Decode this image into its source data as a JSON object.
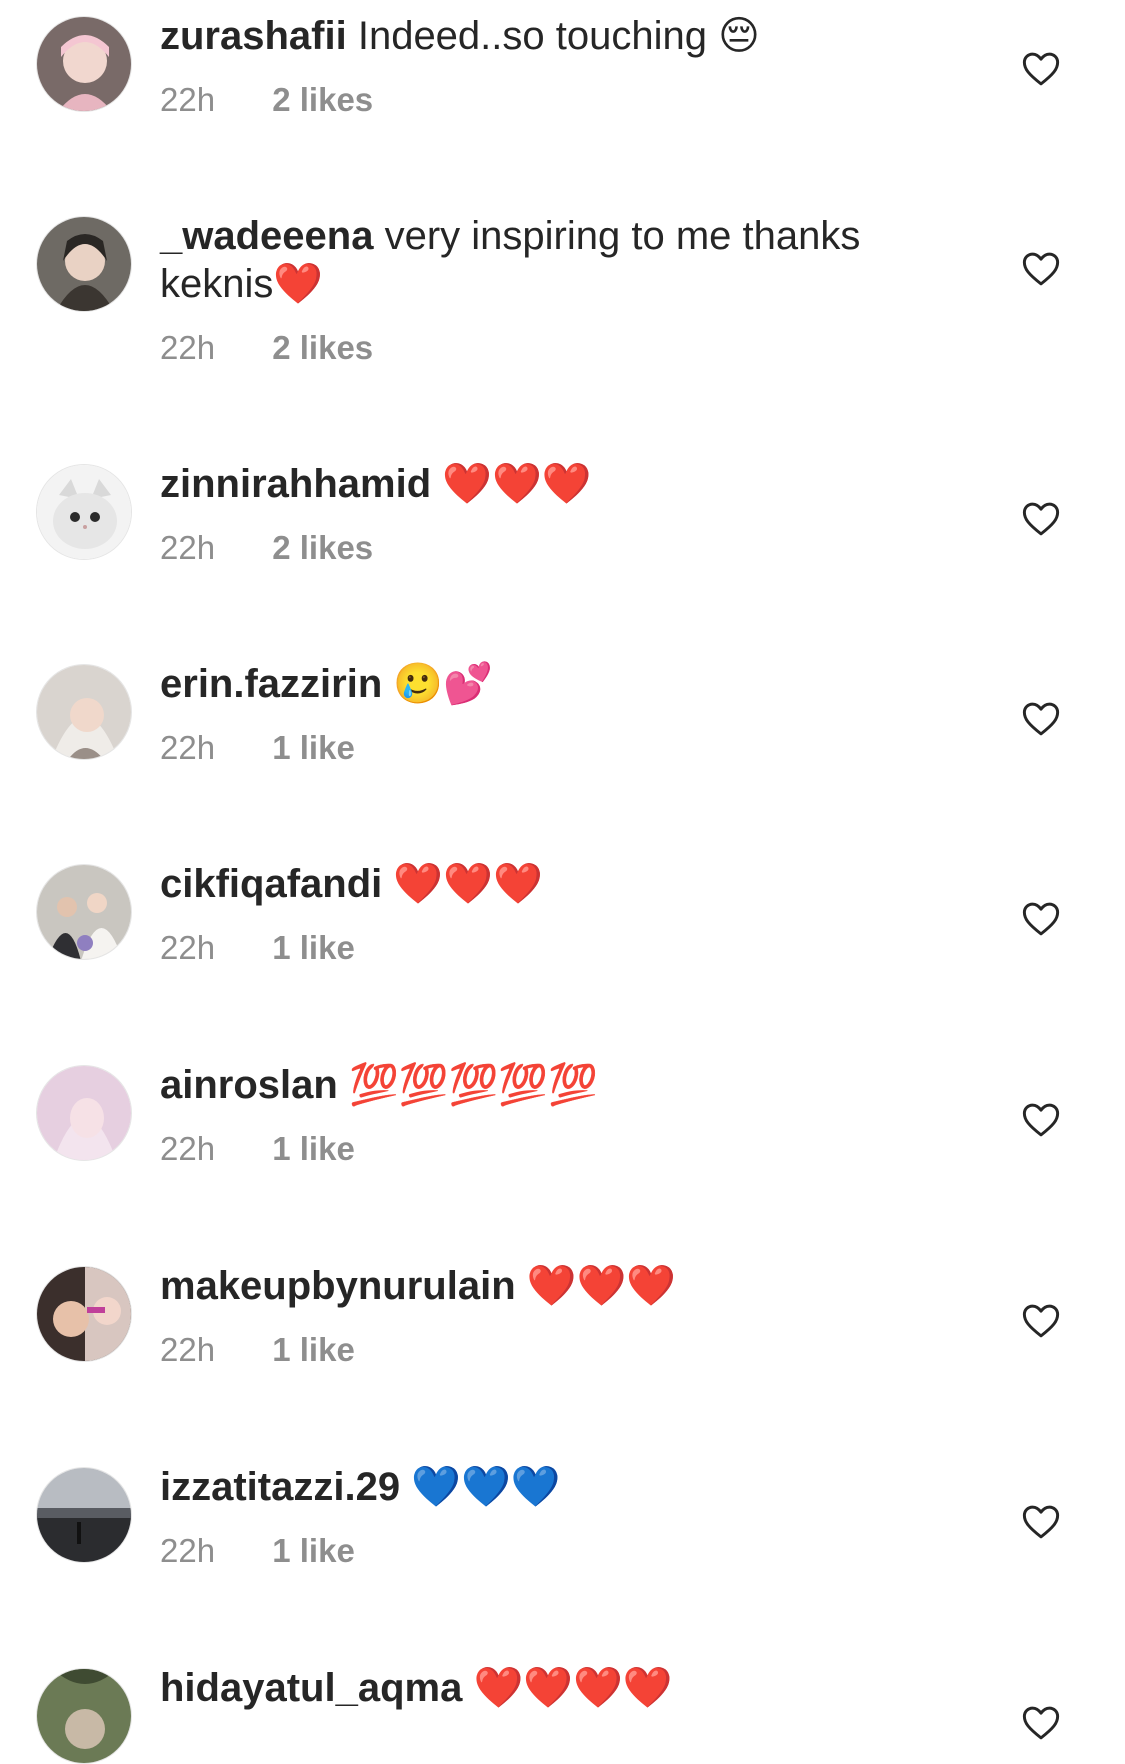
{
  "comments": [
    {
      "username": "zurashafii",
      "text": " Indeed..so touching 😔",
      "time": "22h",
      "likes": "2 likes",
      "avatar_color": "#d6c8c2"
    },
    {
      "username": "_wadeeena",
      "text": " very inspiring to me thanks keknis❤️",
      "time": "22h",
      "likes": "2 likes",
      "avatar_color": "#6e6a64"
    },
    {
      "username": "zinnirahhamid",
      "text": " ❤️❤️❤️",
      "time": "22h",
      "likes": "2 likes",
      "avatar_color": "#eeeeee"
    },
    {
      "username": "erin.fazzirin",
      "text": " 🥲💕",
      "time": "22h",
      "likes": "1 like",
      "avatar_color": "#d9d4cf"
    },
    {
      "username": "cikfiqafandi",
      "text": " ❤️❤️❤️",
      "time": "22h",
      "likes": "1 like",
      "avatar_color": "#c9c6c0"
    },
    {
      "username": "ainroslan",
      "text": " 💯💯💯💯💯",
      "time": "22h",
      "likes": "1 like",
      "avatar_color": "#e6cfe0"
    },
    {
      "username": "makeupbynurulain",
      "text": " ❤️❤️❤️",
      "time": "22h",
      "likes": "1 like",
      "avatar_color": "#3b2f2c"
    },
    {
      "username": "izzatitazzi.29",
      "text": " 💙💙💙",
      "time": "22h",
      "likes": "1 like",
      "avatar_color": "#7a7f86"
    },
    {
      "username": "hidayatul_aqma",
      "text": " ❤️❤️❤️❤️",
      "time": "",
      "likes": "",
      "avatar_color": "#6b7a55"
    }
  ],
  "icons": {
    "like": "heart-outline-icon",
    "avatar": "user-avatar"
  }
}
